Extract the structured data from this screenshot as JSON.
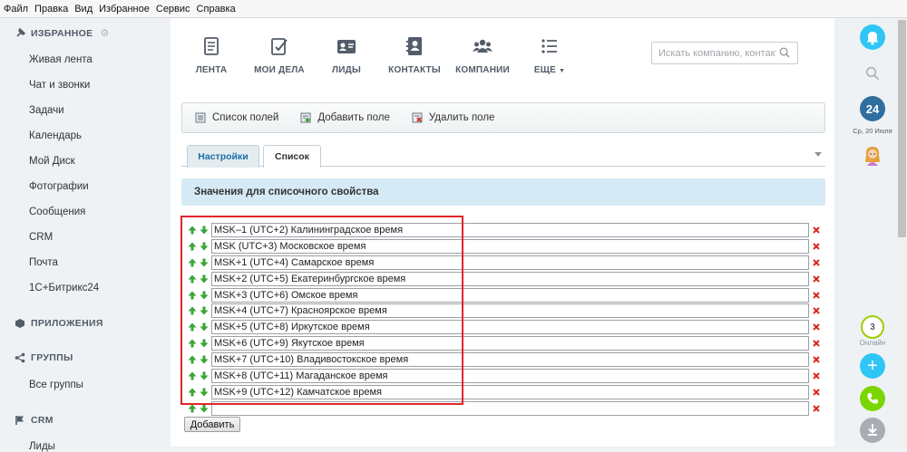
{
  "menubar": {
    "items": [
      "Файл",
      "Правка",
      "Вид",
      "Избранное",
      "Сервис",
      "Справка"
    ]
  },
  "sidebar": {
    "favorites_title": "ИЗБРАННОЕ",
    "favorites": [
      "Живая лента",
      "Чат и звонки",
      "Задачи",
      "Календарь",
      "Мой Диск",
      "Фотографии",
      "Сообщения",
      "CRM",
      "Почта",
      "1С+Битрикс24"
    ],
    "apps_title": "ПРИЛОЖЕНИЯ",
    "groups_title": "ГРУППЫ",
    "groups_item": "Все группы",
    "crm_title": "CRM",
    "crm_item": "Лиды"
  },
  "topnav": {
    "items": [
      {
        "label": "ЛЕНТА",
        "icon": "feed-icon"
      },
      {
        "label": "МОИ ДЕЛА",
        "icon": "tasks-icon"
      },
      {
        "label": "ЛИДЫ",
        "icon": "leads-icon"
      },
      {
        "label": "КОНТАКТЫ",
        "icon": "contacts-icon"
      },
      {
        "label": "КОМПАНИИ",
        "icon": "companies-icon"
      },
      {
        "label": "ЕЩЕ",
        "icon": "more-icon"
      }
    ],
    "search_placeholder": "Искать компанию, контакт"
  },
  "toolbar": {
    "list_fields": "Список полей",
    "add_field": "Добавить поле",
    "delete_field": "Удалить поле"
  },
  "tabs": {
    "settings": "Настройки",
    "list": "Список"
  },
  "section_title": "Значения для списочного свойства",
  "values": [
    "MSK–1 (UTC+2) Калининградское время",
    "MSK (UTC+3) Московское время",
    "MSK+1 (UTC+4) Самарское время",
    "MSK+2 (UTC+5) Екатеринбургское время",
    "MSK+3 (UTC+6) Омское время",
    "MSK+4 (UTC+7) Красноярское время",
    "MSK+5 (UTC+8) Иркутское время",
    "MSK+6 (UTC+9) Якутское время",
    "MSK+7 (UTC+10) Владивостокское время",
    "MSK+8 (UTC+11) Магаданское время",
    "MSK+9 (UTC+12) Камчатское время",
    ""
  ],
  "add_button": "Добавить",
  "rightbar": {
    "badge": "24",
    "date": "Ср, 20 Июля",
    "online_count": "3",
    "online_label": "Онлайн"
  },
  "colors": {
    "accent": "#2fc6f6",
    "highlight": "#e0262b",
    "arrow_green": "#3aa537",
    "delete_red": "#d9261c"
  }
}
